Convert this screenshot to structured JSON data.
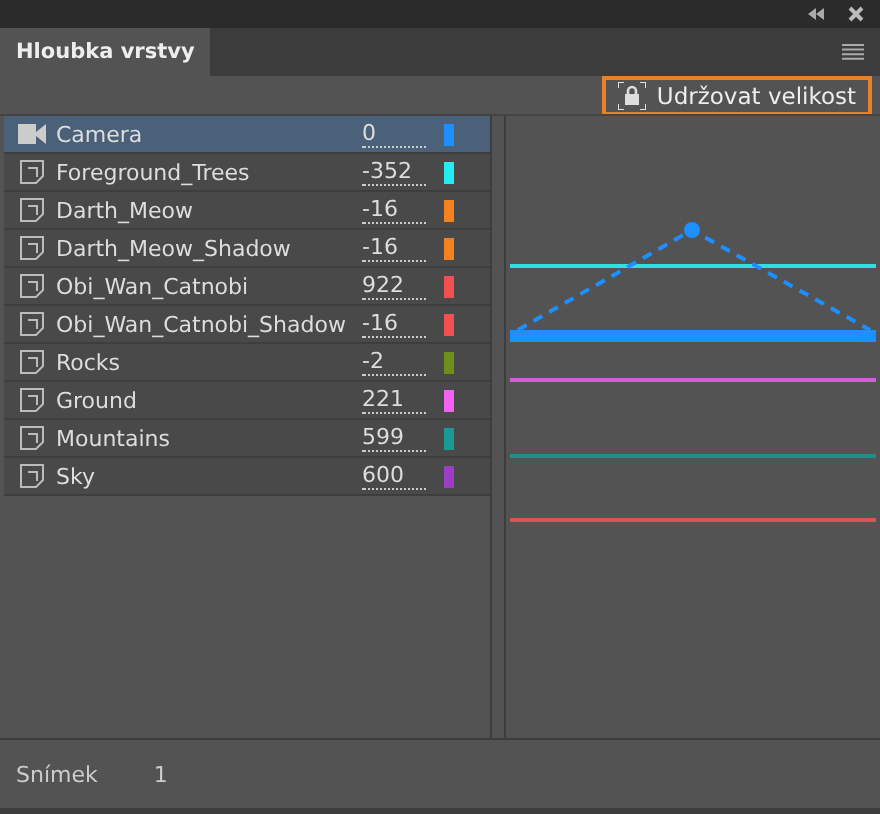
{
  "panel": {
    "tab": "Hloubka vrstvy",
    "keep_size_button": "Udržovat velikost"
  },
  "layers": [
    {
      "kind": "camera",
      "name": "Camera",
      "depth": "0",
      "color": "#1e8fff",
      "selected": true
    },
    {
      "kind": "layer",
      "name": "Foreground_Trees",
      "depth": "-352",
      "color": "#22eef2",
      "selected": false
    },
    {
      "kind": "layer",
      "name": "Darth_Meow",
      "depth": "-16",
      "color": "#f5821f",
      "selected": false
    },
    {
      "kind": "layer",
      "name": "Darth_Meow_Shadow",
      "depth": "-16",
      "color": "#f5821f",
      "selected": false
    },
    {
      "kind": "layer",
      "name": "Obi_Wan_Catnobi",
      "depth": "922",
      "color": "#f25050",
      "selected": false
    },
    {
      "kind": "layer",
      "name": "Obi_Wan_Catnobi_Shadow",
      "depth": "-16",
      "color": "#f25050",
      "selected": false
    },
    {
      "kind": "layer",
      "name": "Rocks",
      "depth": "-2",
      "color": "#6f8e1c",
      "selected": false
    },
    {
      "kind": "layer",
      "name": "Ground",
      "depth": "221",
      "color": "#f561f0",
      "selected": false
    },
    {
      "kind": "layer",
      "name": "Mountains",
      "depth": "599",
      "color": "#1a9a96",
      "selected": false
    },
    {
      "kind": "layer",
      "name": "Sky",
      "depth": "600",
      "color": "#9a3fc4",
      "selected": false
    }
  ],
  "footer": {
    "label": "Snímek",
    "value": "1"
  }
}
